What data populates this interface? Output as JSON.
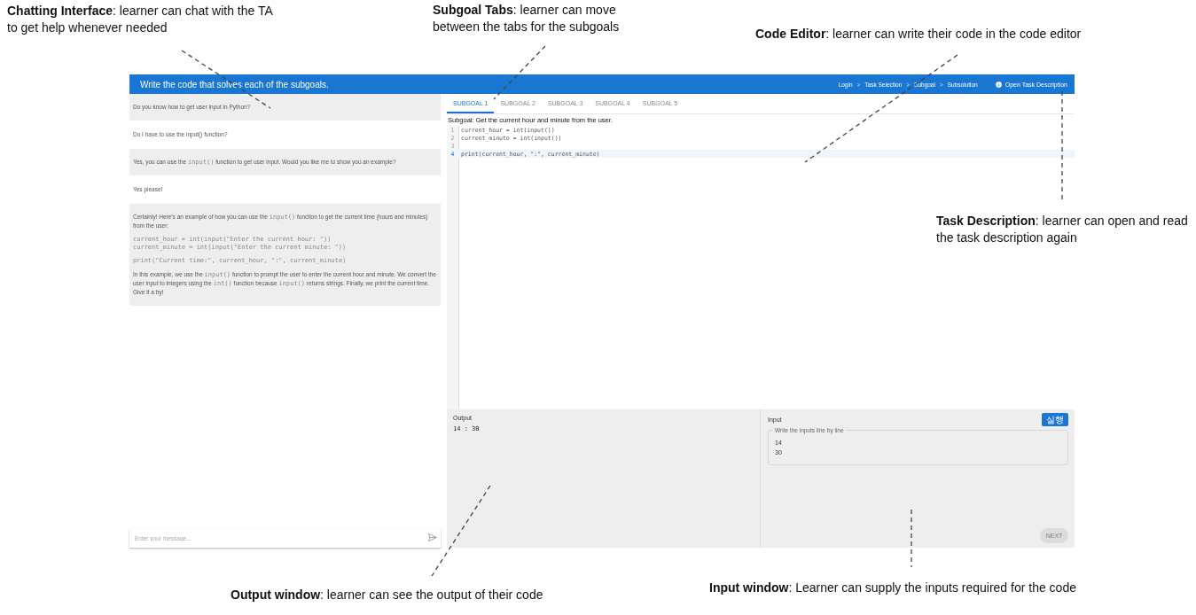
{
  "annotations": [
    {
      "text": "**Chatting Interface**: learner can chat with the TA to get help whenever needed"
    },
    {
      "text": "**Subgoal Tabs**: learner can move between the tabs for the subgoals"
    },
    {
      "text": "**Code Editor**: learner can write their code in the code editor"
    },
    {
      "text": "**Task Description**: learner can open and read the task description again"
    },
    {
      "text": "**Output window**: learner can see the output of their code"
    },
    {
      "text": "**Input window**: Learner can supply the inputs required for the code"
    }
  ],
  "header": {
    "title": "Write the code that solves each of the subgoals.",
    "breadcrumb": [
      {
        "kind": "link",
        "text": "Login"
      },
      {
        "kind": "sep",
        "text": ">"
      },
      {
        "kind": "link",
        "text": "Task Selection"
      },
      {
        "kind": "sep",
        "text": ">"
      },
      {
        "kind": "link",
        "text": "Subgoal"
      },
      {
        "kind": "sep",
        "text": ">"
      },
      {
        "kind": "link",
        "text": "Subsolution"
      }
    ],
    "task_button": "Open Task Description"
  },
  "chat": {
    "messages": [
      {
        "kind": "ta",
        "blocks": [
          {
            "kind": "p",
            "segments": [
              {
                "text": "Do you know how to get user input in Python?",
                "code": false
              }
            ]
          }
        ]
      },
      {
        "kind": "learner",
        "blocks": [
          {
            "kind": "p",
            "segments": [
              {
                "text": "Do I have to use the input() function?",
                "code": false
              }
            ]
          }
        ]
      },
      {
        "kind": "ta",
        "blocks": [
          {
            "kind": "p",
            "segments": [
              {
                "text": "Yes, you can use the ",
                "code": false
              },
              {
                "text": "input()",
                "code": true
              },
              {
                "text": " function to get user input. Would you like me to show you an example?",
                "code": false
              }
            ]
          }
        ]
      },
      {
        "kind": "learner",
        "blocks": [
          {
            "kind": "p",
            "segments": [
              {
                "text": "Yes please!",
                "code": false
              }
            ]
          }
        ]
      },
      {
        "kind": "ta",
        "blocks": [
          {
            "kind": "p",
            "segments": [
              {
                "text": "Certainly! Here's an example of how you can use the ",
                "code": false
              },
              {
                "text": "input()",
                "code": true
              },
              {
                "text": " function to get the current time (hours and minutes) from the user:",
                "code": false
              }
            ]
          },
          {
            "kind": "code",
            "lines": [
              "current_hour = int(input(\"Enter the current hour: \"))",
              "current_minute = int(input(\"Enter the current minute: \"))"
            ]
          },
          {
            "kind": "code",
            "lines": [
              "print(\"Current time:\", current_hour, \":\", current_minute)"
            ]
          },
          {
            "kind": "p",
            "segments": [
              {
                "text": "In this example, we use the ",
                "code": false
              },
              {
                "text": "input()",
                "code": true
              },
              {
                "text": " function to prompt the user to enter the current hour and minute. We convert the user input to integers using the ",
                "code": false
              },
              {
                "text": "int()",
                "code": true
              },
              {
                "text": " function because ",
                "code": false
              },
              {
                "text": "input()",
                "code": true
              },
              {
                "text": " returns strings. Finally, we print the current time. Give it a try!",
                "code": false
              }
            ]
          }
        ]
      }
    ],
    "input": {
      "placeholder": "Enter your message..."
    }
  },
  "tabs": [
    {
      "label": "SUBGOAL 1",
      "selected": true
    },
    {
      "label": "SUBGOAL 2",
      "selected": false
    },
    {
      "label": "SUBGOAL 3",
      "selected": false
    },
    {
      "label": "SUBGOAL 4",
      "selected": false
    },
    {
      "label": "SUBGOAL 5",
      "selected": false
    }
  ],
  "subgoal": "Subgoal: Get the current hour and minute from the user.",
  "editor": {
    "lines": [
      {
        "number": "1",
        "code": "current_hour = int(input())",
        "selected": false
      },
      {
        "number": "2",
        "code": "current_minute = int(input())",
        "selected": false
      },
      {
        "number": "3",
        "selected": false
      },
      {
        "number": "4",
        "code": "print(current_hour, \":\", current_minute)",
        "selected": true
      }
    ]
  },
  "output": {
    "label": "Output",
    "value": "14 : 30"
  },
  "input_panel": {
    "label": "Input",
    "run_button": "실행",
    "field_label": "Write the inputs line by line",
    "value": "14\n30",
    "next_button": {
      "label": "NEXT",
      "disabled": true
    }
  }
}
